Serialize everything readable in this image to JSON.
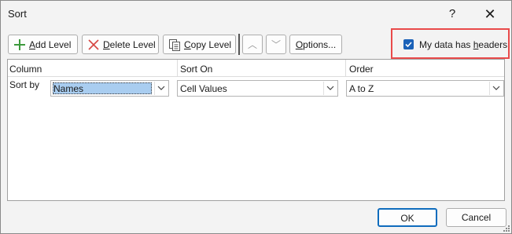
{
  "window": {
    "title": "Sort",
    "help_glyph": "?",
    "close_glyph": "✕"
  },
  "toolbar": {
    "add_level": {
      "accel": "A",
      "rest": "dd Level",
      "icon": "plus-icon"
    },
    "delete_level": {
      "accel": "D",
      "rest": "elete Level",
      "icon": "x-icon"
    },
    "copy_level": {
      "accel": "C",
      "rest": "opy Level",
      "icon": "copy-icon"
    },
    "move_up_glyph": "︿",
    "move_down_glyph": "﹀",
    "options": {
      "accel": "O",
      "rest": "ptions..."
    }
  },
  "headers_option": {
    "prefix": "My data has ",
    "accel": "h",
    "rest": "eaders",
    "checked": true
  },
  "grid": {
    "columns": [
      "Column",
      "Sort On",
      "Order"
    ],
    "row_label": "Sort by",
    "rows": [
      {
        "column": "Names",
        "sort_on": "Cell Values",
        "order": "A to Z"
      }
    ]
  },
  "footer": {
    "ok_label": "OK",
    "cancel_label": "Cancel"
  },
  "colors": {
    "accent": "#0f6cbd",
    "checkbox": "#1a61b8",
    "highlight": "#e94a4a",
    "selection": "#a9cdf0"
  }
}
